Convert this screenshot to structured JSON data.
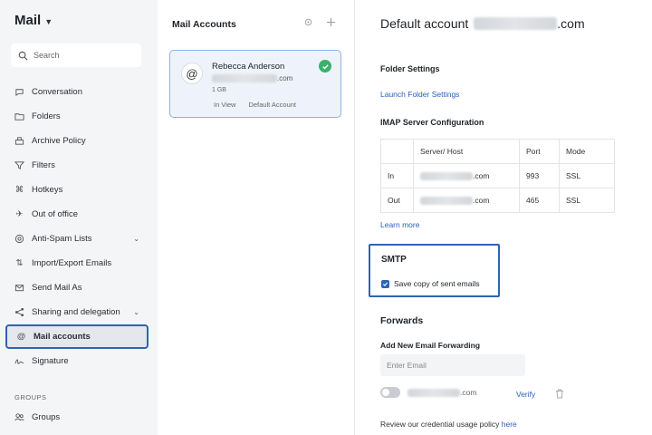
{
  "app": {
    "title": "Mail"
  },
  "search": {
    "placeholder": "Search"
  },
  "sidebar": {
    "items": [
      {
        "label": "Conversation",
        "icon": "conversation-icon"
      },
      {
        "label": "Folders",
        "icon": "folder-icon"
      },
      {
        "label": "Archive Policy",
        "icon": "archive-icon"
      },
      {
        "label": "Filters",
        "icon": "filter-icon"
      },
      {
        "label": "Hotkeys",
        "icon": "command-icon"
      },
      {
        "label": "Out of office",
        "icon": "plane-icon"
      },
      {
        "label": "Anti-Spam Lists",
        "icon": "shield-icon"
      },
      {
        "label": "Import/Export Emails",
        "icon": "import-export-icon"
      },
      {
        "label": "Send Mail As",
        "icon": "send-as-icon"
      },
      {
        "label": "Sharing and delegation",
        "icon": "share-icon"
      },
      {
        "label": "Mail accounts",
        "icon": "at-icon"
      },
      {
        "label": "Signature",
        "icon": "signature-icon"
      }
    ],
    "groups_label": "GROUPS",
    "groups_item": "Groups"
  },
  "middle": {
    "title": "Mail Accounts",
    "account": {
      "name": "Rebecca Anderson",
      "email_suffix": ".com",
      "size": "1 GB",
      "status": "In View",
      "type": "Default Account"
    }
  },
  "right": {
    "title_prefix": "Default account",
    "title_suffix": ".com",
    "folder_settings": "Folder Settings",
    "launch_folder_settings": "Launch Folder Settings",
    "imap_heading": "IMAP Server Configuration",
    "table": {
      "headers": [
        "",
        "Server/ Host",
        "Port",
        "Mode"
      ],
      "rows": [
        {
          "label": "In",
          "host_suffix": ".com",
          "port": "993",
          "mode": "SSL"
        },
        {
          "label": "Out",
          "host_suffix": ".com",
          "port": "465",
          "mode": "SSL"
        }
      ]
    },
    "learn_more": "Learn more",
    "smtp": {
      "title": "SMTP",
      "save_copy": "Save copy of sent emails"
    },
    "forwards": {
      "title": "Forwards",
      "add_label": "Add New Email Forwarding",
      "input_placeholder": "Enter Email",
      "fwd_email_suffix": ".com",
      "verify": "Verify"
    },
    "policy_text": "Review our credential usage policy",
    "policy_link": "here"
  },
  "colors": {
    "accent": "#2f64b0",
    "link": "#2c5fb3",
    "success": "#39b26b"
  }
}
